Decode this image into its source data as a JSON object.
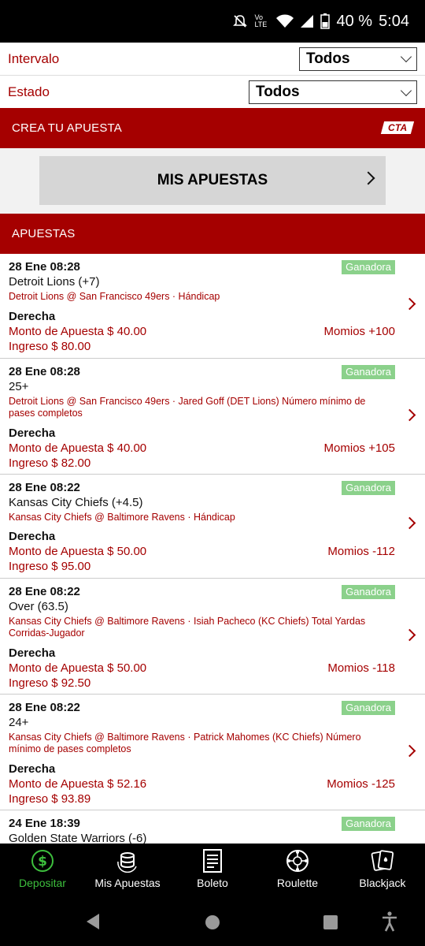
{
  "status": {
    "battery": "40 %",
    "time": "5:04",
    "volte": "Vo LTE"
  },
  "filters": {
    "interval": {
      "label": "Intervalo",
      "value": "Todos"
    },
    "state": {
      "label": "Estado",
      "value": "Todos"
    }
  },
  "create_bet": {
    "label": "CREA TU APUESTA",
    "badge": "CTA"
  },
  "my_bets_button": "MIS APUESTAS",
  "bets_header": "APUESTAS",
  "bets": [
    {
      "date": "28 Ene 08:28",
      "status": "Ganadora",
      "selection": "Detroit Lions (+7)",
      "event": "Detroit Lions @ San Francisco 49ers · Hándicap",
      "side": "Derecha",
      "amount": "Monto de Apuesta $ 40.00",
      "odds": "Momios +100",
      "income": "Ingreso $ 80.00"
    },
    {
      "date": "28 Ene 08:28",
      "status": "Ganadora",
      "selection": "25+",
      "event": "Detroit Lions @ San Francisco 49ers · Jared Goff (DET Lions) Número mínimo de pases completos",
      "side": "Derecha",
      "amount": "Monto de Apuesta $ 40.00",
      "odds": "Momios +105",
      "income": "Ingreso $ 82.00"
    },
    {
      "date": "28 Ene 08:22",
      "status": "Ganadora",
      "selection": "Kansas City Chiefs (+4.5)",
      "event": "Kansas City Chiefs @ Baltimore Ravens · Hándicap",
      "side": "Derecha",
      "amount": "Monto de Apuesta $ 50.00",
      "odds": "Momios -112",
      "income": "Ingreso $ 95.00"
    },
    {
      "date": "28 Ene 08:22",
      "status": "Ganadora",
      "selection": "Over (63.5)",
      "event": "Kansas City Chiefs @ Baltimore Ravens · Isiah Pacheco (KC Chiefs) Total Yardas Corridas-Jugador",
      "side": "Derecha",
      "amount": "Monto de Apuesta $ 50.00",
      "odds": "Momios -118",
      "income": "Ingreso $ 92.50"
    },
    {
      "date": "28 Ene 08:22",
      "status": "Ganadora",
      "selection": "24+",
      "event": "Kansas City Chiefs @ Baltimore Ravens · Patrick Mahomes (KC Chiefs) Número mínimo de pases completos",
      "side": "Derecha",
      "amount": "Monto de Apuesta $ 52.16",
      "odds": "Momios -125",
      "income": "Ingreso $ 93.89"
    },
    {
      "date": "24 Ene 18:39",
      "status": "Ganadora",
      "selection": "Golden State Warriors (-6)"
    }
  ],
  "bottom_nav": [
    {
      "label": "Depositar",
      "icon": "dollar-icon",
      "active_color": "#3dbf3d"
    },
    {
      "label": "Mis Apuestas",
      "icon": "coins-icon"
    },
    {
      "label": "Boleto",
      "icon": "ticket-icon"
    },
    {
      "label": "Roulette",
      "icon": "roulette-icon"
    },
    {
      "label": "Blackjack",
      "icon": "cards-icon"
    }
  ],
  "colors": {
    "brand_red": "#a50000",
    "win_badge": "#8bd18b",
    "active_nav": "#3dbf3d"
  }
}
